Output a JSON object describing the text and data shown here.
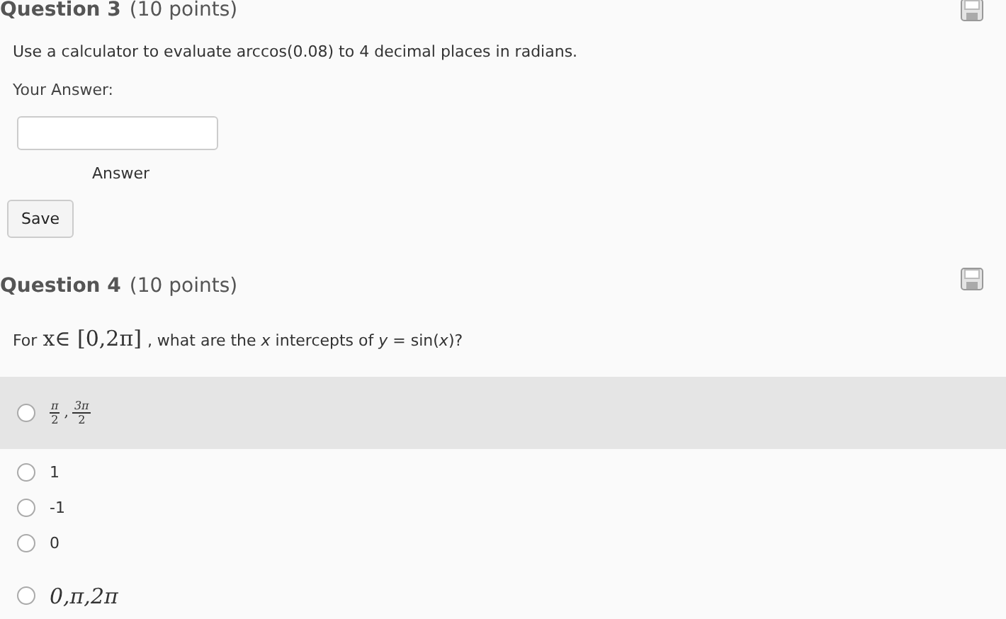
{
  "questions": [
    {
      "title": "Question 3",
      "points": "(10 points)",
      "prompt": "Use a calculator to evaluate arccos(0.08) to 4 decimal places in radians.",
      "answer_label": "Your Answer:",
      "answer_caption": "Answer",
      "save_button": "Save"
    },
    {
      "title": "Question 4",
      "points": "(10 points)",
      "prompt_lead": "For",
      "prompt_math": "x∈ [0,2π]",
      "prompt_rest": ", what are the *x* intercepts of *y* = sin(*x*)?",
      "options": [
        {
          "kind": "fractions",
          "terms": [
            {
              "num": "π",
              "den": "2"
            },
            {
              "num": "3π",
              "den": "2"
            }
          ],
          "separator": ",",
          "selected": false,
          "highlighted": true
        },
        {
          "kind": "text",
          "label": "1",
          "selected": false,
          "highlighted": false
        },
        {
          "kind": "text",
          "label": "-1",
          "selected": false,
          "highlighted": false
        },
        {
          "kind": "text",
          "label": "0",
          "selected": false,
          "highlighted": false
        },
        {
          "kind": "math",
          "label": "0,π,2π",
          "selected": false,
          "highlighted": false
        }
      ]
    }
  ]
}
